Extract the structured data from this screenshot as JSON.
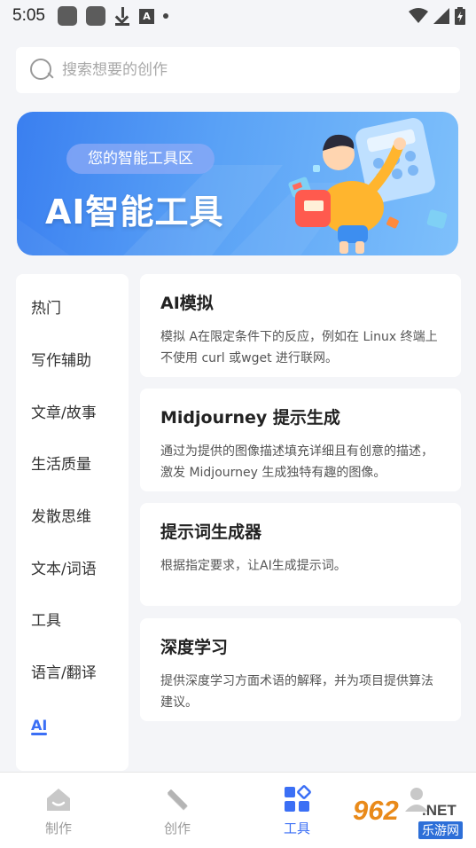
{
  "status_bar": {
    "time": "5:05",
    "a_badge": "A"
  },
  "search": {
    "placeholder": "搜索想要的创作"
  },
  "banner": {
    "tag": "您的智能工具区",
    "title": "AI智能工具"
  },
  "categories": [
    {
      "label": "热门",
      "active": false
    },
    {
      "label": "写作辅助",
      "active": false
    },
    {
      "label": "文章/故事",
      "active": false
    },
    {
      "label": "生活质量",
      "active": false
    },
    {
      "label": "发散思维",
      "active": false
    },
    {
      "label": "文本/词语",
      "active": false
    },
    {
      "label": "工具",
      "active": false
    },
    {
      "label": "语言/翻译",
      "active": false
    },
    {
      "label": "AI",
      "active": true
    }
  ],
  "tools": [
    {
      "title": "AI模拟",
      "desc": "模拟 A在限定条件下的反应，例如在 Linux 终端上不使用 curl 或wget 进行联网。"
    },
    {
      "title": "Midjourney 提示生成",
      "desc": "通过为提供的图像描述填充详细且有创意的描述，激发 Midjourney 生成独特有趣的图像。"
    },
    {
      "title": "提示词生成器",
      "desc": "根据指定要求，让AI生成提示词。"
    },
    {
      "title": "深度学习",
      "desc": "提供深度学习方面术语的解释，并为项目提供算法建议。"
    }
  ],
  "bottom_nav": [
    {
      "label": "制作",
      "icon": "home-icon",
      "active": false
    },
    {
      "label": "创作",
      "icon": "pen-ruler-icon",
      "active": false
    },
    {
      "label": "工具",
      "icon": "tools-grid-icon",
      "active": true
    },
    {
      "label": "",
      "icon": "profile-icon",
      "active": false
    }
  ],
  "watermark": {
    "number": "962",
    "domain": ".NET",
    "site": "乐游网"
  },
  "colors": {
    "accent": "#3b6ff5",
    "background": "#f4f5f8",
    "card": "#ffffff",
    "nav_inactive": "#9b9b9b"
  }
}
